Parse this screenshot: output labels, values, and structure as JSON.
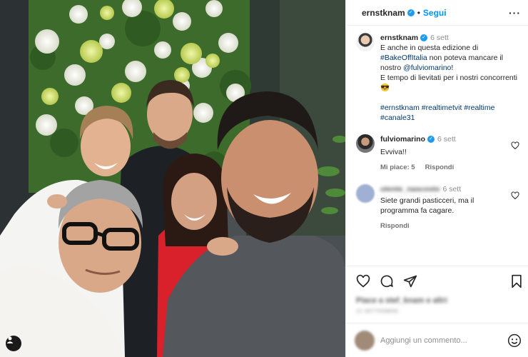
{
  "header": {
    "username": "ernstknam",
    "dot": "•",
    "follow_label": "Segui",
    "more_label": "···"
  },
  "caption": {
    "username": "ernstknam",
    "time": "6 sett",
    "line1": "E anche in questa edizione di",
    "hashtag_bake": "#BakeOffItalia",
    "line2": " non poteva mancare il nostro ",
    "mention": "@fulviomarino",
    "line3": "!",
    "line4": "E tempo di lievitati per i nostri concorrenti 😎",
    "hashtags": "#ernstknam #realtimetvit #realtime #canale31"
  },
  "comments": [
    {
      "username": "fulviomarino",
      "time": "6 sett",
      "text": "Evviva!!",
      "likes": "Mi piace: 5",
      "reply": "Rispondi"
    },
    {
      "username": "utente_nascosto",
      "time": "6 sett",
      "text": "Siete grandi pasticceri, ma il programma fa cagare.",
      "reply": "Rispondi"
    }
  ],
  "post": {
    "likes_text": "Piace a stef_knam e altri",
    "date": "22 SETTEMBRE"
  },
  "add_comment": {
    "placeholder": "Aggiungi un commento..."
  },
  "colors": {
    "link": "#00376b",
    "follow": "#0095f6",
    "verified": "#1d9bf0",
    "muted": "#8e8e8e"
  },
  "icons": [
    "tag-people-icon",
    "verified-icon",
    "more-icon",
    "heart-icon",
    "comment-icon",
    "share-icon",
    "bookmark-icon",
    "emoji-icon"
  ]
}
